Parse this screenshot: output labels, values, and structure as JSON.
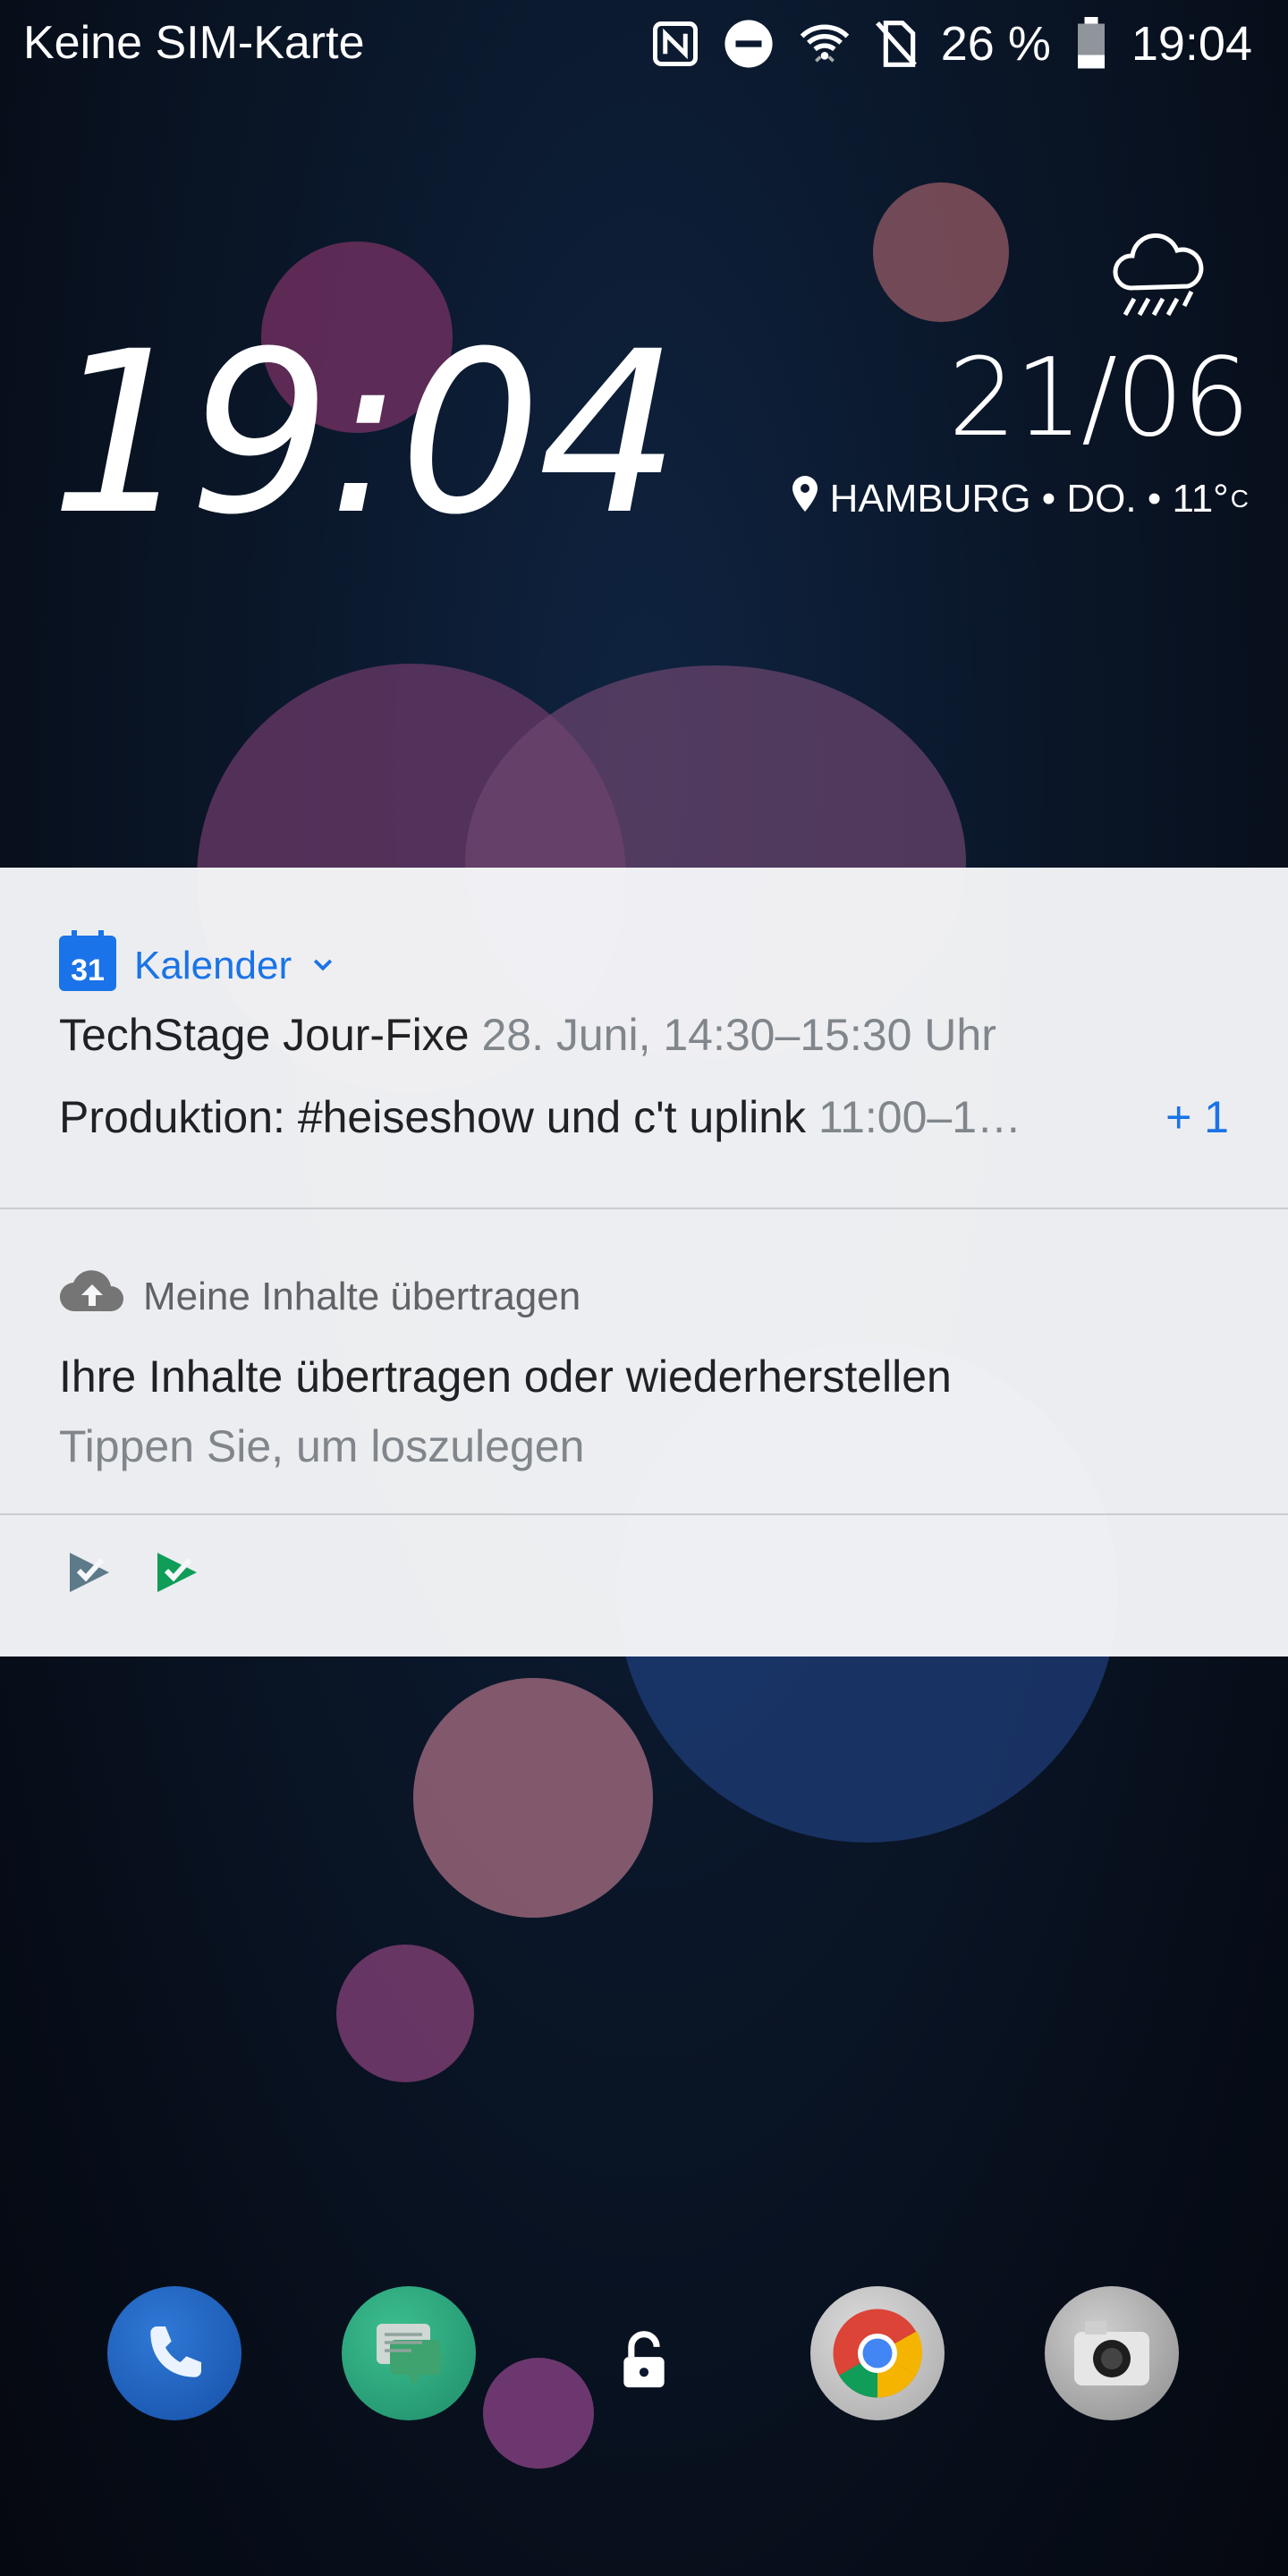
{
  "status_bar": {
    "carrier": "Keine SIM-Karte",
    "battery": "26 %",
    "time": "19:04",
    "icons": [
      "nfc-icon",
      "dnd-icon",
      "wifi-icon",
      "no-sim-icon",
      "battery-icon"
    ]
  },
  "lockscreen": {
    "clock": "19:04",
    "date": "21/06",
    "location": "HAMBURG • DO. • 11°",
    "temp_unit": "C",
    "weather": "rain-cloud-icon"
  },
  "notifications": {
    "calendar": {
      "app": "Kalender",
      "event1_title": "TechStage Jour-Fixe",
      "event1_time": "28. Juni, 14:30–15:30 Uhr",
      "event2_title": "Produktion: #heiseshow und c't uplink",
      "event2_time": "11:00–1…",
      "more": "+ 1",
      "icon_day": "31"
    },
    "transfer": {
      "app": "Meine Inhalte übertragen",
      "title": "Ihre Inhalte übertragen oder wiederherstellen",
      "subtitle": "Tippen Sie, um loszulegen"
    },
    "collapsed_icons": [
      "tasks-grey-icon",
      "tasks-green-icon"
    ]
  },
  "dock": {
    "apps": [
      "phone-app-icon",
      "messages-app-icon",
      "chrome-app-icon",
      "camera-app-icon"
    ],
    "lock": "unlock-icon"
  },
  "colors": {
    "accent": "#1a73e8",
    "panel_bg": "#f6f7f9",
    "wallpaper": "#0a1628"
  }
}
